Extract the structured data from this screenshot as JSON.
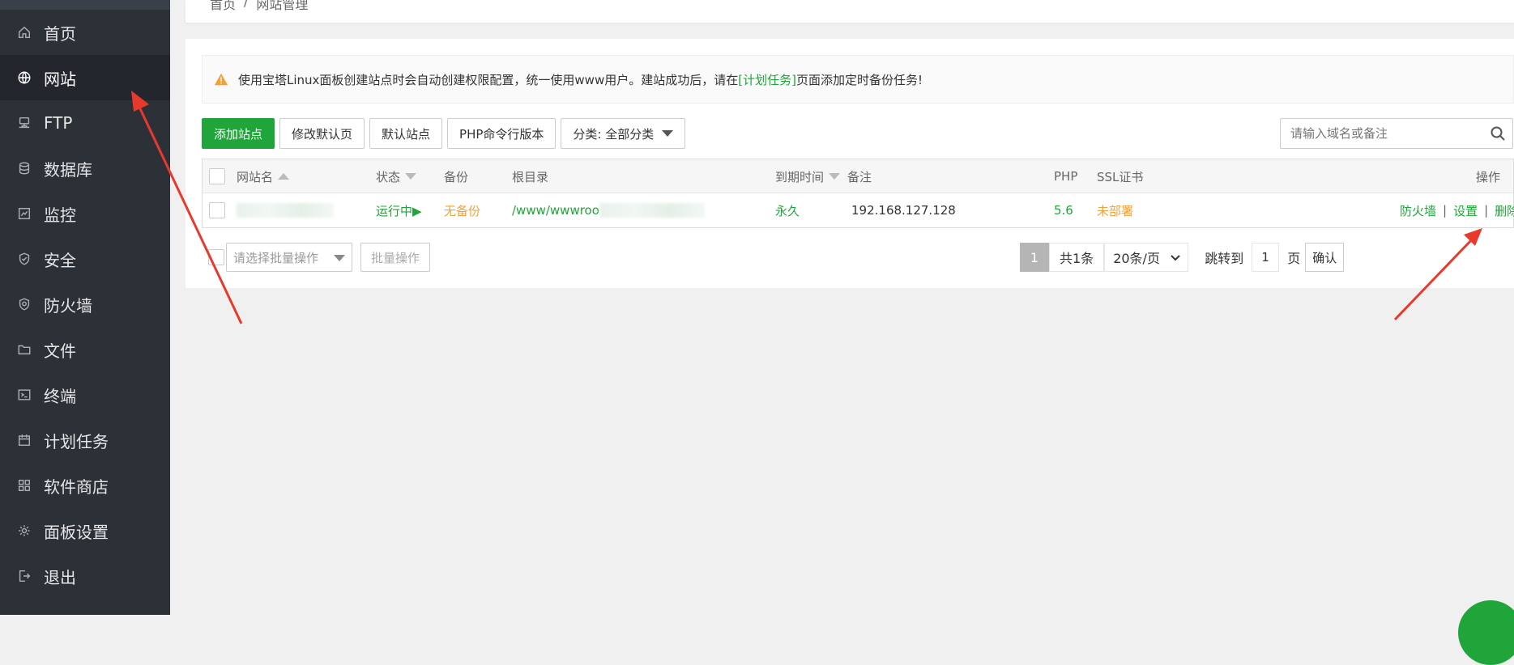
{
  "sidebar": {
    "items": [
      {
        "label": "首页",
        "icon": "home-icon"
      },
      {
        "label": "网站",
        "icon": "globe-icon",
        "active": true
      },
      {
        "label": "FTP",
        "icon": "ftp-icon"
      },
      {
        "label": "数据库",
        "icon": "database-icon"
      },
      {
        "label": "监控",
        "icon": "monitor-icon"
      },
      {
        "label": "安全",
        "icon": "shield-icon"
      },
      {
        "label": "防火墙",
        "icon": "firewall-icon"
      },
      {
        "label": "文件",
        "icon": "folder-icon"
      },
      {
        "label": "终端",
        "icon": "terminal-icon"
      },
      {
        "label": "计划任务",
        "icon": "calendar-icon"
      },
      {
        "label": "软件商店",
        "icon": "grid-icon"
      },
      {
        "label": "面板设置",
        "icon": "gear-icon"
      },
      {
        "label": "退出",
        "icon": "logout-icon"
      }
    ]
  },
  "breadcrumb": {
    "home": "首页",
    "sep": "/",
    "current": "网站管理"
  },
  "notice": {
    "prefix": "使用宝塔Linux面板创建站点时会自动创建权限配置，统一使用www用户。建站成功后，请在",
    "link": "[计划任务]",
    "suffix": "页面添加定时备份任务!"
  },
  "toolbar": {
    "add_site": "添加站点",
    "edit_default": "修改默认页",
    "default_site": "默认站点",
    "php_cli": "PHP命令行版本",
    "category": "分类: 全部分类"
  },
  "search": {
    "placeholder": "请输入域名或备注"
  },
  "table": {
    "headers": {
      "name": "网站名",
      "status": "状态",
      "backup": "备份",
      "root": "根目录",
      "expire": "到期时间",
      "remark": "备注",
      "php": "PHP",
      "ssl": "SSL证书",
      "actions": "操作"
    },
    "rows": [
      {
        "status": "运行中▶",
        "backup": "无备份",
        "root": "/www/wwwroo",
        "expire": "永久",
        "remark": "192.168.127.128",
        "php": "5.6",
        "ssl": "未部署",
        "op_firewall": "防火墙",
        "op_settings": "设置",
        "op_delete": "删除",
        "op_sep": "|"
      }
    ]
  },
  "bottom": {
    "batch_placeholder": "请选择批量操作",
    "batch_button": "批量操作",
    "page_current": "1",
    "total": "共1条",
    "per_page": "20条/页",
    "jump_label": "跳转到",
    "jump_value": "1",
    "page_unit": "页",
    "confirm": "确认"
  },
  "colors": {
    "accent": "#20a53a",
    "warning": "#f0a13a",
    "sidebar": "#2c3138",
    "annotation": "#e8392d"
  }
}
